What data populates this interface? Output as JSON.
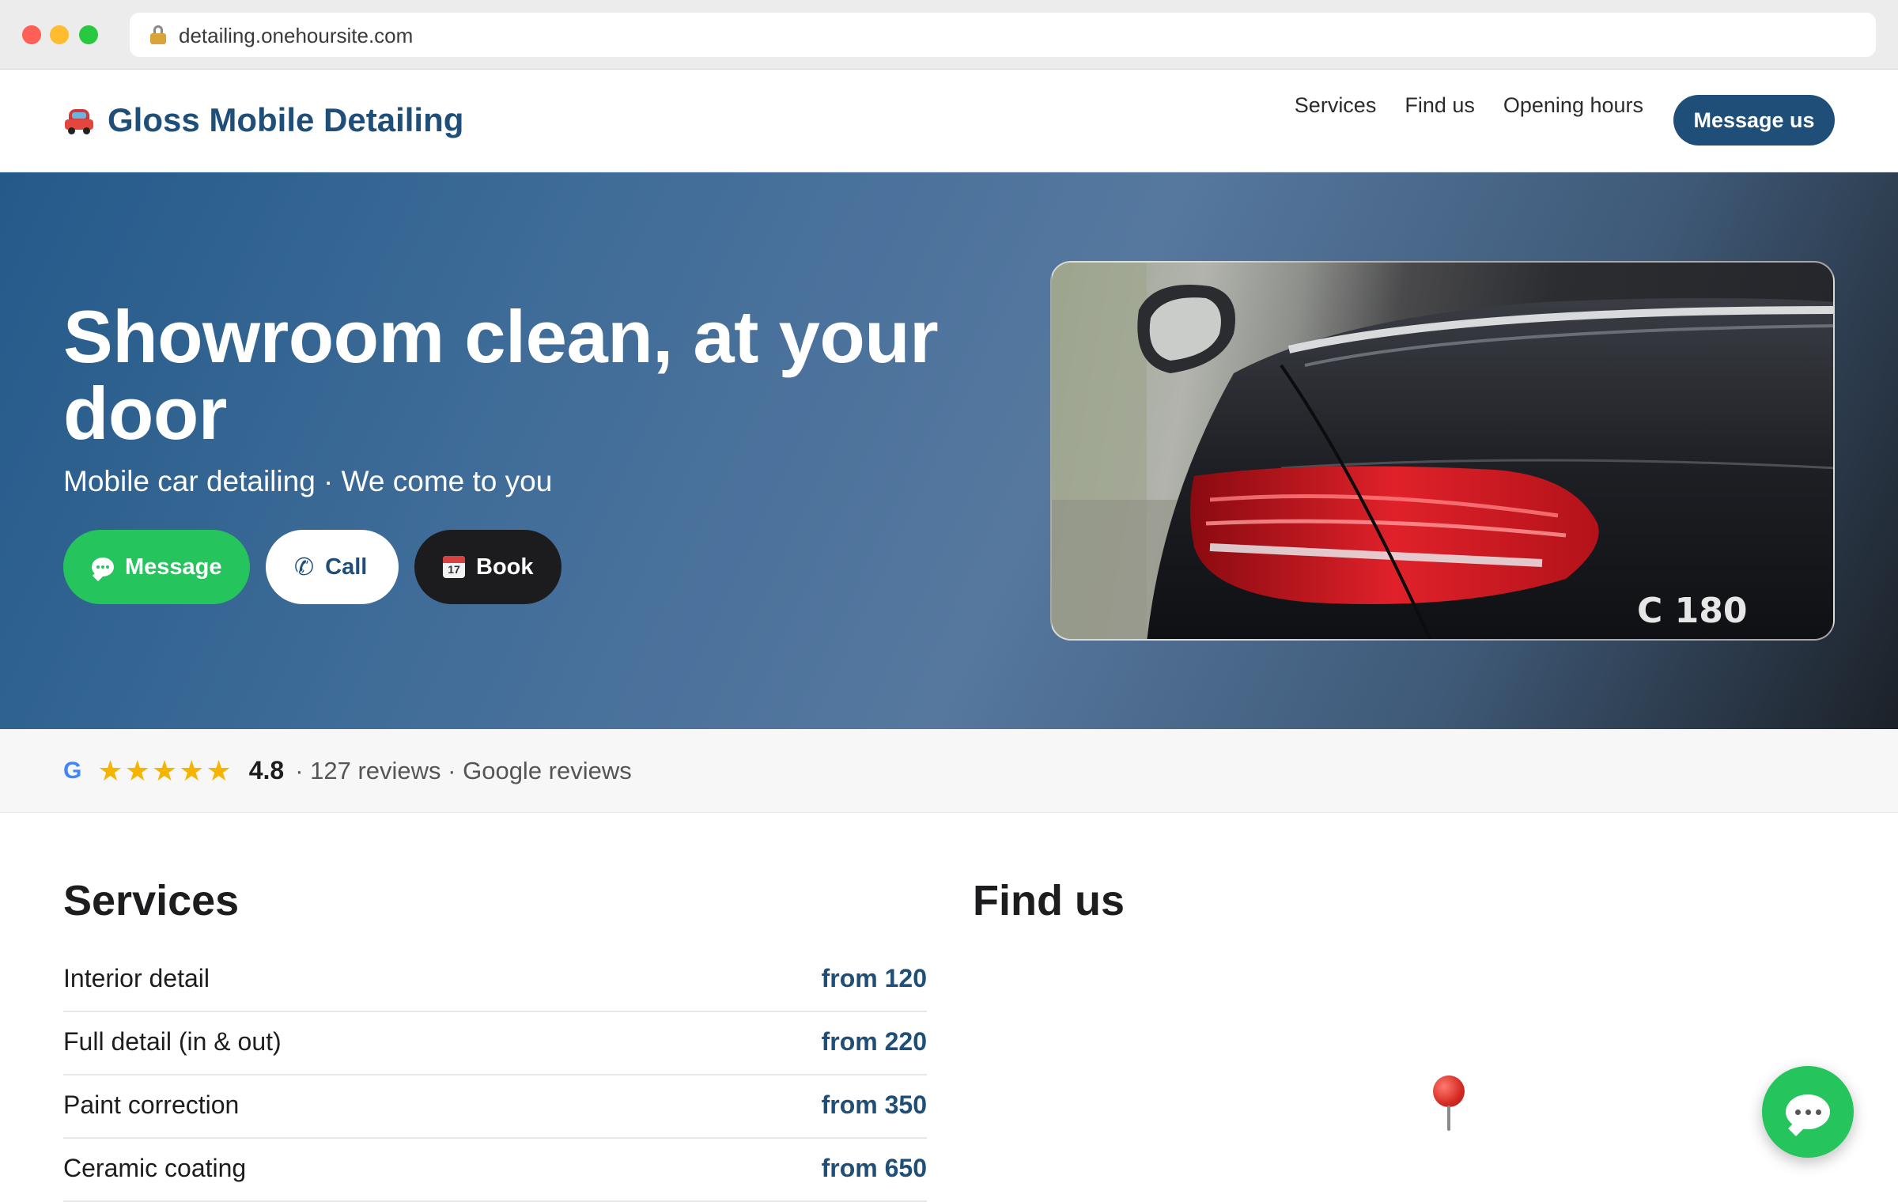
{
  "browser": {
    "url": "detailing.onehoursite.com"
  },
  "header": {
    "brand": "Gloss Mobile Detailing",
    "nav": [
      "Services",
      "Find us",
      "Opening hours"
    ],
    "cta": "Message us"
  },
  "hero": {
    "title": "Showroom clean, at your door",
    "subtitle": "Mobile car detailing · We come to you",
    "buttons": {
      "message": "Message",
      "call": "Call",
      "book": "Book"
    },
    "image_badge": "C 180",
    "calendar_day": "17"
  },
  "reviews": {
    "source_icon": "G",
    "stars": "★★★★★",
    "rating": "4.8",
    "meta": "· 127 reviews · Google reviews"
  },
  "services": {
    "title": "Services",
    "items": [
      {
        "name": "Interior detail",
        "price": "from 120"
      },
      {
        "name": "Full detail (in & out)",
        "price": "from 220"
      },
      {
        "name": "Paint correction",
        "price": "from 350"
      },
      {
        "name": "Ceramic coating",
        "price": "from 650"
      }
    ]
  },
  "find_us": {
    "title": "Find us"
  },
  "colors": {
    "brand": "#1f4e79",
    "whatsapp_green": "#25c45c",
    "star": "#f4b400"
  },
  "icons": [
    "lock-icon",
    "car-icon",
    "chat-bubble-icon",
    "phone-icon",
    "calendar-icon",
    "google-icon",
    "map-pin-icon"
  ]
}
